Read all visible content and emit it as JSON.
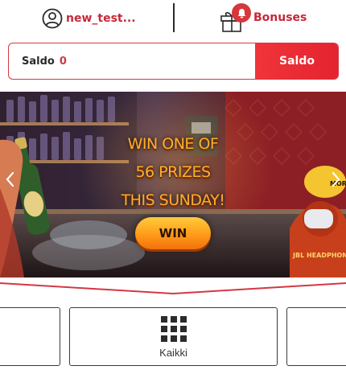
{
  "header": {
    "username": "new_test...",
    "bonuses_label": "Bonuses"
  },
  "balance": {
    "label": "Saldo",
    "value": "0",
    "button_label": "Saldo"
  },
  "banner": {
    "line1": "WIN ONE OF",
    "line2": "56 PRIZES",
    "line3": "THIS SUNDAY!",
    "cta": "WIN",
    "prize_tag": "JBL HEADPHON",
    "side_tag": "MOR"
  },
  "categories": {
    "main_label": "Kaikki"
  },
  "colors": {
    "accent": "#c62838",
    "button_red": "#e4232e",
    "promo_text": "#ffae2a"
  },
  "icons": {
    "user": "user-circle-icon",
    "gift": "gift-icon",
    "bell": "bell-icon",
    "grid": "grid-icon"
  }
}
